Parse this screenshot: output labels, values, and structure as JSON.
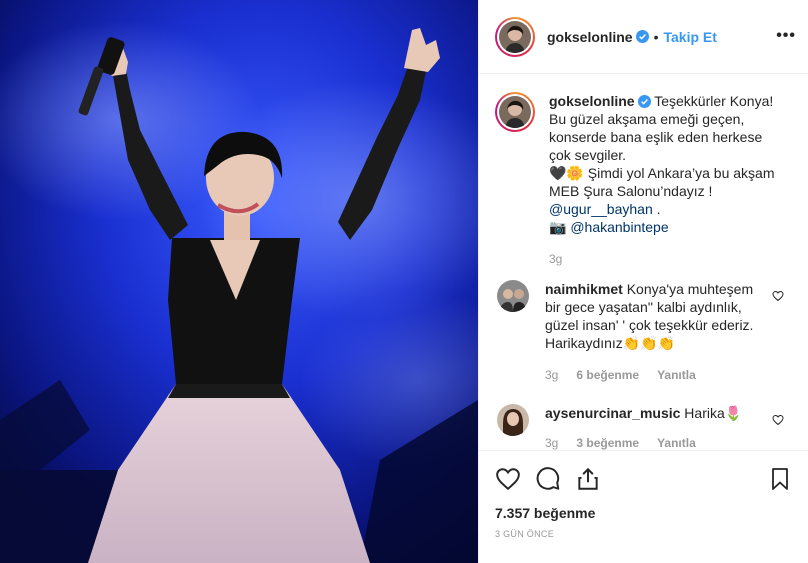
{
  "account": {
    "username": "gokselonline",
    "follow_label": "Takip Et",
    "more_label": "•••"
  },
  "caption": {
    "username": "gokselonline",
    "text_line1": "Teşekkürler Konya! Bu güzel akşama emeği geçen, konserde bana eşlik eden herkese çok sevgiler.",
    "text_line2": "🖤🌼 Şimdi yol Ankara’ya bu akşam MEB Şura Salonu’ndayız !",
    "mention1": "@ugur__bayhan",
    "mention1_suffix": " .",
    "camera_emoji": "📷",
    "mention2": "@hakanbintepe",
    "time": "3g"
  },
  "comments": [
    {
      "username": "naimhikmet",
      "text": "Konya'ya muhteşem bir gece yaşatan'' kalbi aydınlık, güzel insan' ' çok teşekkür ederiz. Harikaydınız👏👏👏",
      "time": "3g",
      "likes": "6 beğenme",
      "reply": "Yanıtla"
    },
    {
      "username": "aysenurcinar_music",
      "text": "Harika🌷",
      "time": "3g",
      "likes": "3 beğenme",
      "reply": "Yanıtla"
    }
  ],
  "footer": {
    "likes": "7.357 beğenme",
    "date": "3 GÜN ÖNCE"
  },
  "colors": {
    "link": "#3897f0",
    "verified": "#3897f0",
    "meta": "#999999",
    "stage_blue": "#0a1a8c"
  }
}
